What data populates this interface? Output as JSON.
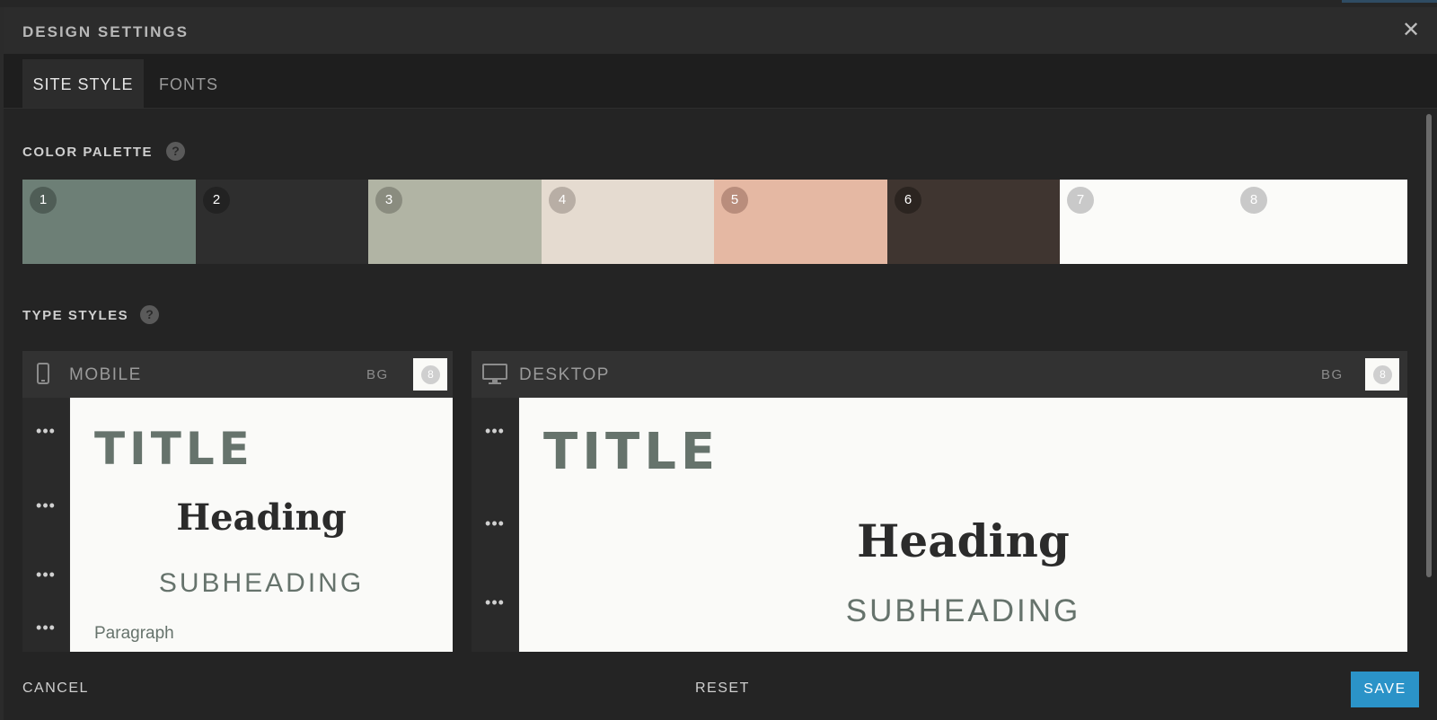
{
  "modal": {
    "title": "DESIGN SETTINGS",
    "close_icon": "close-icon"
  },
  "tabs": [
    {
      "label": "SITE STYLE",
      "active": true
    },
    {
      "label": "FONTS",
      "active": false
    }
  ],
  "color_palette": {
    "label": "COLOR PALETTE",
    "help": "?",
    "swatches": [
      {
        "number": "1",
        "color": "#6d7f76",
        "badge": "#4f5d56"
      },
      {
        "number": "2",
        "color": "#2e2e2e",
        "badge": "#222222"
      },
      {
        "number": "3",
        "color": "#b1b4a4",
        "badge": "#8a8c7f"
      },
      {
        "number": "4",
        "color": "#e5dbd0",
        "badge": "#b8aea5"
      },
      {
        "number": "5",
        "color": "#e5b8a3",
        "badge": "#b98d7c"
      },
      {
        "number": "6",
        "color": "#3f3530",
        "badge": "#2b2420"
      },
      {
        "number": "7",
        "color": "#fbfbf9",
        "badge": "#c9c9c9"
      },
      {
        "number": "8",
        "color": "#fbfbf9",
        "badge": "#c9c9c9"
      }
    ]
  },
  "type_styles": {
    "label": "TYPE STYLES",
    "help": "?",
    "mobile": {
      "label": "MOBILE",
      "bg_label": "BG",
      "bg_value": "8",
      "title": "TITLE",
      "heading": "Heading",
      "subheading": "SUBHEADING",
      "paragraph": "Paragraph"
    },
    "desktop": {
      "label": "DESKTOP",
      "bg_label": "BG",
      "bg_value": "8",
      "title": "TITLE",
      "heading": "Heading",
      "subheading": "SUBHEADING"
    },
    "more_icon": "•••"
  },
  "footer": {
    "cancel": "CANCEL",
    "reset": "RESET",
    "save": "SAVE"
  },
  "colors": {
    "accent": "#2b93c8",
    "title_color": "#66736c",
    "heading_color": "#2b2b2b"
  }
}
